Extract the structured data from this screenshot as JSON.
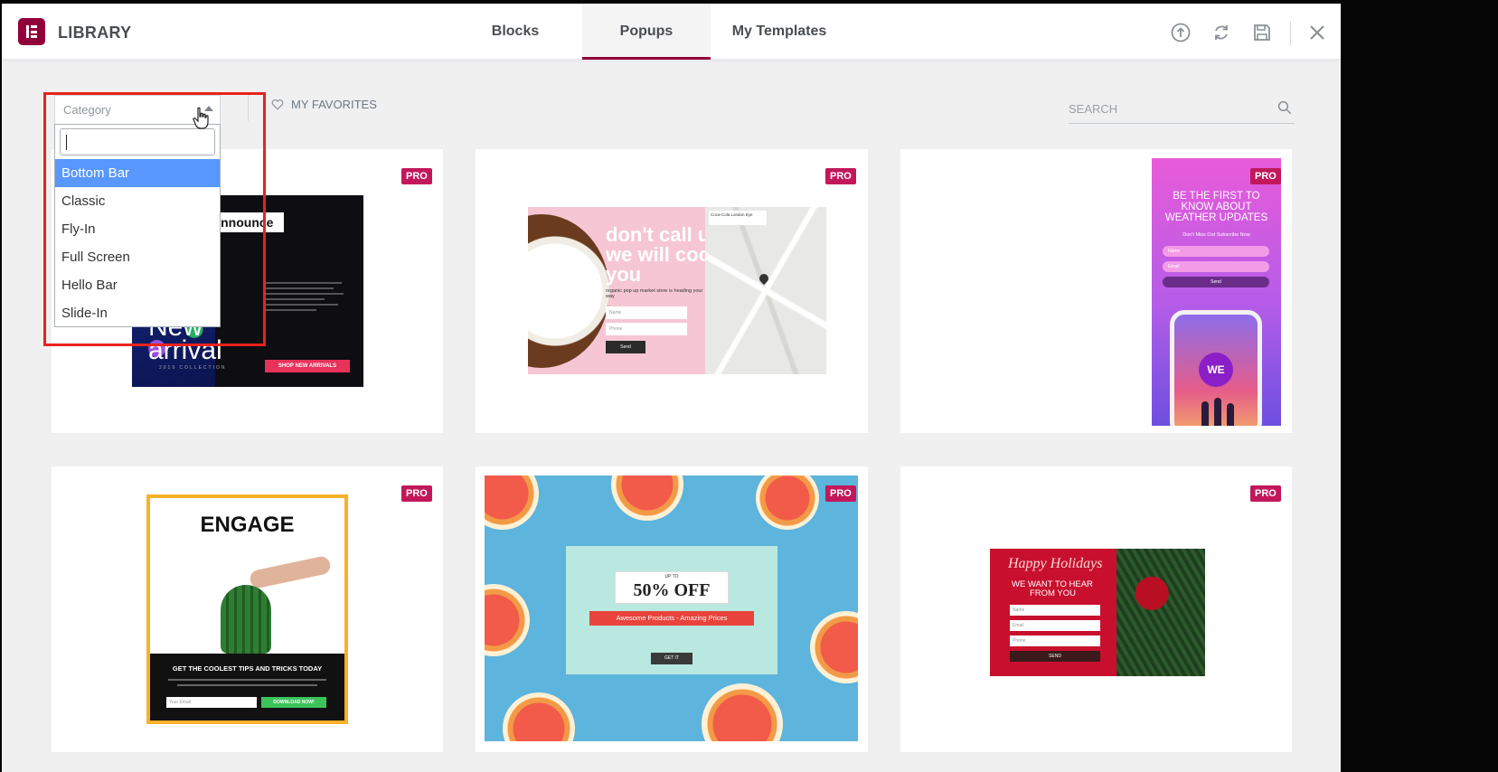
{
  "header": {
    "title": "LIBRARY",
    "tabs": [
      {
        "label": "Blocks",
        "active": false
      },
      {
        "label": "Popups",
        "active": true
      },
      {
        "label": "My Templates",
        "active": false
      }
    ],
    "accent_color": "#92003b"
  },
  "toolbar": {
    "category_placeholder": "Category",
    "favorites_label": "MY FAVORITES",
    "search_placeholder": "SEARCH"
  },
  "dropdown": {
    "search_value": "",
    "options": [
      "Bottom Bar",
      "Classic",
      "Fly-In",
      "Full Screen",
      "Hello Bar",
      "Slide-In"
    ],
    "selected_index": 0
  },
  "badge": "PRO",
  "cards": [
    {
      "badge": "PRO",
      "thumb": {
        "heading": "Announce",
        "big1": "New",
        "big2": "arrival",
        "sub": "2019 COLLECTION",
        "cta": "SHOP NEW ARRIVALS"
      }
    },
    {
      "badge": "PRO",
      "thumb": {
        "line1": "don't call us",
        "line2": "we will coconut",
        "line3": "you",
        "sub": "organic pop up market store is heading your way",
        "f1": "Name",
        "f2": "Phone",
        "cta": "Send",
        "map_title": "Coca-Cola London Eye"
      }
    },
    {
      "badge": "PRO",
      "thumb": {
        "line1": "BE THE FIRST TO",
        "line2": "KNOW ABOUT",
        "line3": "WEATHER UPDATES",
        "sub": "Don't Miss Out Subscribe Now",
        "f1": "Name",
        "f2": "Email",
        "cta": "Send",
        "logo": "WE"
      }
    },
    {
      "badge": "PRO",
      "thumb": {
        "heading": "ENGAGE",
        "tagline": "GET THE COOLEST TIPS AND TRICKS TODAY",
        "f1": "Your Email",
        "cta": "DOWNLOAD NOW!"
      }
    },
    {
      "badge": "PRO",
      "thumb": {
        "upto": "UP TO",
        "big": "50% OFF",
        "ribbon": "Awesome Products - Amazing Prices",
        "cta": "GET IT"
      }
    },
    {
      "badge": "PRO",
      "thumb": {
        "script": "Happy Holidays",
        "line1": "WE WANT TO HEAR",
        "line2": "FROM YOU",
        "f1": "Name",
        "f2": "Email",
        "f3": "Phone",
        "cta": "SEND"
      }
    }
  ]
}
